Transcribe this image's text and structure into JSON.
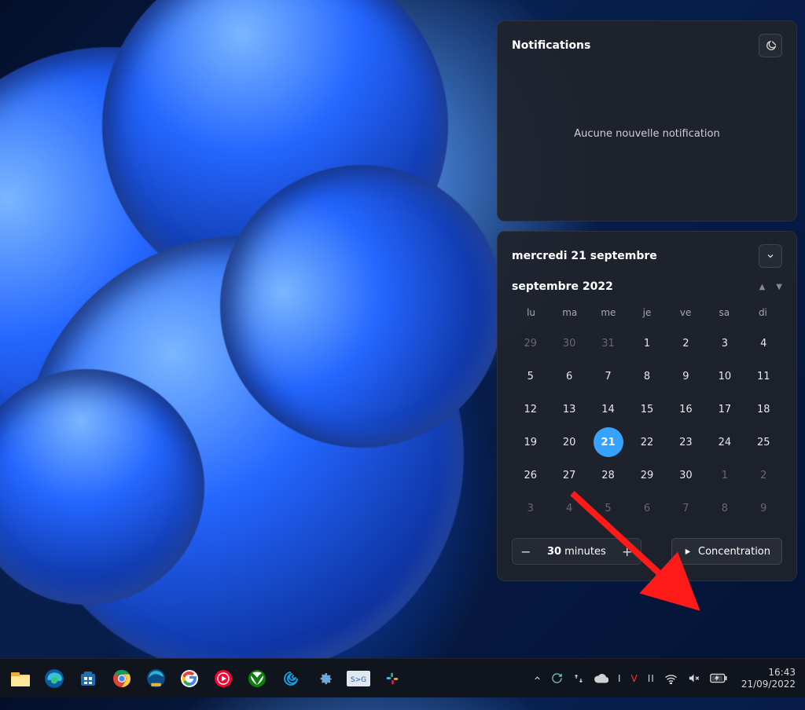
{
  "notifications": {
    "title": "Notifications",
    "empty_message": "Aucune nouvelle notification"
  },
  "calendar": {
    "date_header": "mercredi 21 septembre",
    "month_label": "septembre 2022",
    "weekdays": [
      "lu",
      "ma",
      "me",
      "je",
      "ve",
      "sa",
      "di"
    ],
    "grid": [
      {
        "n": "29",
        "state": "dim"
      },
      {
        "n": "30",
        "state": "dim"
      },
      {
        "n": "31",
        "state": "dim"
      },
      {
        "n": "1",
        "state": "cur"
      },
      {
        "n": "2",
        "state": "cur"
      },
      {
        "n": "3",
        "state": "cur"
      },
      {
        "n": "4",
        "state": "cur"
      },
      {
        "n": "5",
        "state": "cur"
      },
      {
        "n": "6",
        "state": "cur"
      },
      {
        "n": "7",
        "state": "cur"
      },
      {
        "n": "8",
        "state": "cur"
      },
      {
        "n": "9",
        "state": "cur"
      },
      {
        "n": "10",
        "state": "cur"
      },
      {
        "n": "11",
        "state": "cur"
      },
      {
        "n": "12",
        "state": "cur"
      },
      {
        "n": "13",
        "state": "cur"
      },
      {
        "n": "14",
        "state": "cur"
      },
      {
        "n": "15",
        "state": "cur"
      },
      {
        "n": "16",
        "state": "cur"
      },
      {
        "n": "17",
        "state": "cur"
      },
      {
        "n": "18",
        "state": "cur"
      },
      {
        "n": "19",
        "state": "cur"
      },
      {
        "n": "20",
        "state": "cur"
      },
      {
        "n": "21",
        "state": "today"
      },
      {
        "n": "22",
        "state": "cur"
      },
      {
        "n": "23",
        "state": "cur"
      },
      {
        "n": "24",
        "state": "cur"
      },
      {
        "n": "25",
        "state": "cur"
      },
      {
        "n": "26",
        "state": "cur"
      },
      {
        "n": "27",
        "state": "cur"
      },
      {
        "n": "28",
        "state": "cur"
      },
      {
        "n": "29",
        "state": "cur"
      },
      {
        "n": "30",
        "state": "cur"
      },
      {
        "n": "1",
        "state": "dim"
      },
      {
        "n": "2",
        "state": "dim"
      },
      {
        "n": "3",
        "state": "dim"
      },
      {
        "n": "4",
        "state": "dim"
      },
      {
        "n": "5",
        "state": "dim"
      },
      {
        "n": "6",
        "state": "dim"
      },
      {
        "n": "7",
        "state": "dim"
      },
      {
        "n": "8",
        "state": "dim"
      },
      {
        "n": "9",
        "state": "dim"
      }
    ],
    "focus_duration_value": "30",
    "focus_duration_unit": "minutes",
    "focus_button": "Concentration"
  },
  "taskbar": {
    "time": "16:43",
    "date": "21/09/2022"
  }
}
